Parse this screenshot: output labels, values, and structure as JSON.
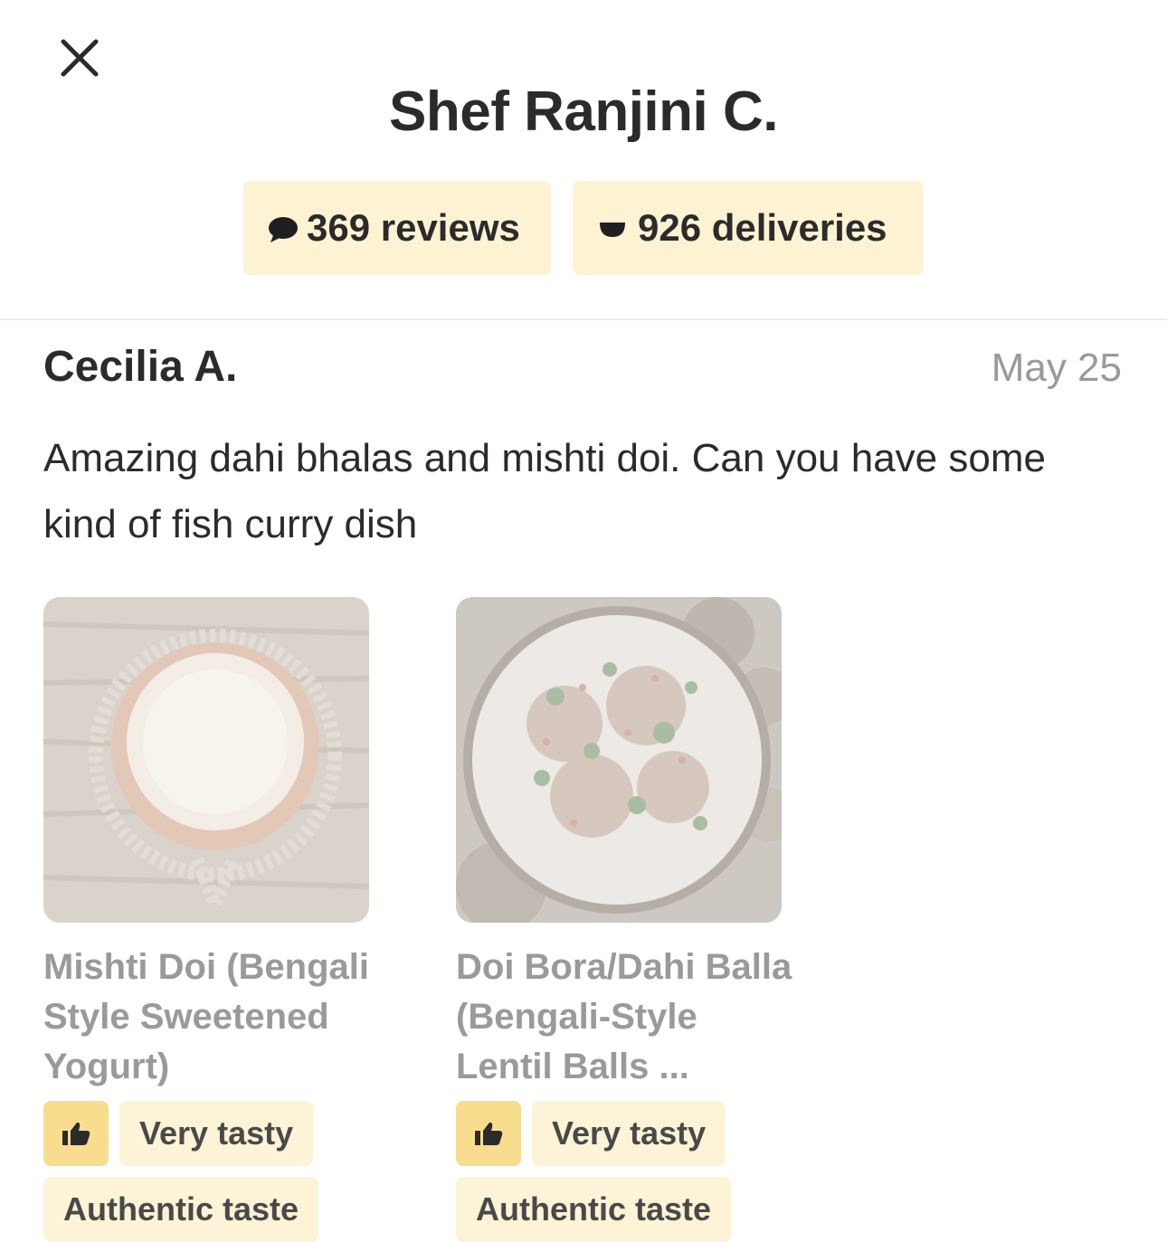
{
  "header": {
    "close_label": "Close",
    "title": "Shef Ranjini C."
  },
  "stats": {
    "reviews": "369 reviews",
    "deliveries": "926 deliveries"
  },
  "review": {
    "author": "Cecilia A.",
    "date": "May 25",
    "text": "Amazing dahi bhalas and mishti doi. Can you have some kind of fish curry dish"
  },
  "dishes": [
    {
      "name": "Mishti Doi (Bengali Style Sweetened Yogurt)",
      "tags": [
        "Very tasty",
        "Authentic taste"
      ]
    },
    {
      "name": "Doi Bora/Dahi Balla (Bengali-Style Lentil Balls ...",
      "tags": [
        "Very tasty",
        "Authentic taste"
      ]
    }
  ],
  "colors": {
    "chip_bg": "#fdf3d3",
    "thumb_chip_bg": "#f8dd8f",
    "text_primary": "#2b2b2b",
    "text_muted": "#9a9a9a"
  },
  "icons": {
    "close": "close-icon",
    "reviews": "chat-bubble-icon",
    "deliveries": "delivery-bowl-icon",
    "tag": "thumbs-up-icon"
  }
}
